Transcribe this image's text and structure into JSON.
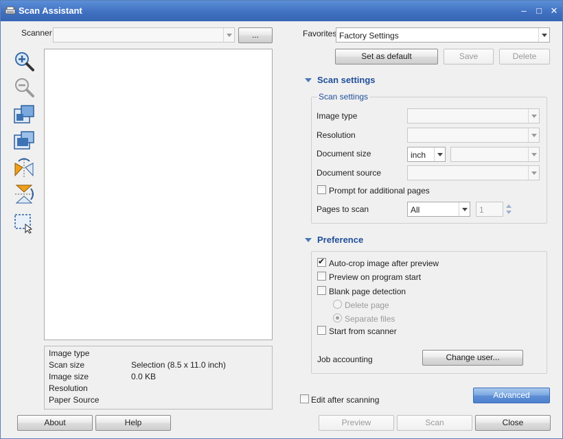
{
  "window": {
    "title": "Scan Assistant",
    "minimize_glyph": "–",
    "maximize_glyph": "□",
    "close_glyph": "✕"
  },
  "scanner": {
    "label": "Scanner",
    "value": "",
    "browse_label": "..."
  },
  "info": {
    "rows": [
      {
        "label": "Image type",
        "value": ""
      },
      {
        "label": "Scan size",
        "value": "Selection (8.5 x 11.0 inch)"
      },
      {
        "label": "Image size",
        "value": "0.0 KB"
      },
      {
        "label": "Resolution",
        "value": ""
      },
      {
        "label": "Paper Source",
        "value": ""
      }
    ]
  },
  "favorites": {
    "label": "Favorites",
    "value": "Factory Settings",
    "set_default_label": "Set as default",
    "save_label": "Save",
    "delete_label": "Delete"
  },
  "scan_settings": {
    "section_label": "Scan settings",
    "group_label": "Scan settings",
    "image_type_label": "Image type",
    "resolution_label": "Resolution",
    "document_size_label": "Document size",
    "document_size_unit": "inch",
    "document_source_label": "Document source",
    "prompt_label": "Prompt for additional pages",
    "pages_label": "Pages to scan",
    "pages_value": "All",
    "pages_count": "1"
  },
  "preference": {
    "section_label": "Preference",
    "autocrop_label": "Auto-crop image after preview",
    "autocrop_checked": true,
    "preview_start_label": "Preview on program start",
    "blank_label": "Blank page detection",
    "delete_page_label": "Delete page",
    "separate_label": "Separate files",
    "start_scanner_label": "Start from scanner",
    "job_label": "Job accounting",
    "change_user_label": "Change user..."
  },
  "bottom": {
    "edit_after_label": "Edit after scanning",
    "advanced_label": "Advanced",
    "about_label": "About",
    "help_label": "Help",
    "preview_label": "Preview",
    "scan_label": "Scan",
    "close_label": "Close"
  },
  "tools": [
    "zoom-in-icon",
    "zoom-out-icon",
    "fit-page-icon",
    "fit-width-icon",
    "flip-horizontal-icon",
    "flip-vertical-icon",
    "select-area-icon"
  ],
  "colors": {
    "titlebar": "#3f6fc0",
    "section_heading": "#1f4e9a",
    "advanced_button": "#5e8fd6"
  }
}
